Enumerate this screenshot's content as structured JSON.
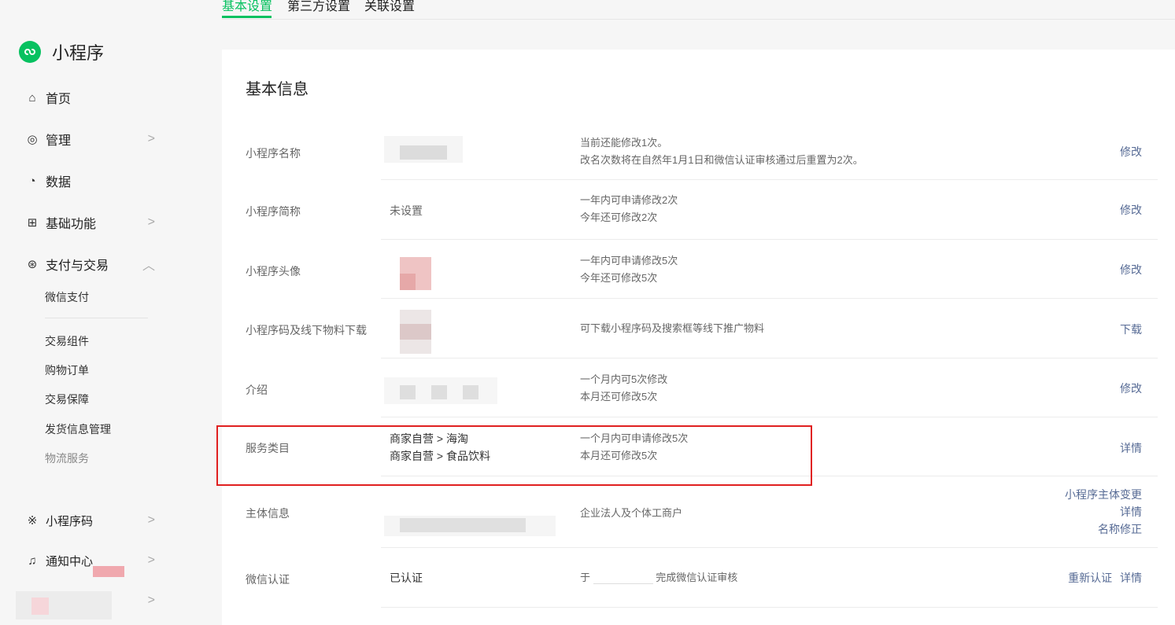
{
  "tabs": [
    "基本设置",
    "第三方设置",
    "关联设置"
  ],
  "sidebar": {
    "app_title": "小程序",
    "nav": [
      {
        "label": "首页",
        "icon": "home-icon"
      },
      {
        "label": "管理",
        "icon": "settings-icon"
      },
      {
        "label": "数据",
        "icon": "chart-icon"
      },
      {
        "label": "基础功能",
        "icon": "grid-icon"
      },
      {
        "label": "支付与交易",
        "icon": "yen-icon"
      }
    ],
    "payment_items": [
      "微信支付",
      "交易组件",
      "购物订单",
      "交易保障",
      "发货信息管理",
      "物流服务"
    ],
    "bottom_nav": [
      {
        "label": "小程序码",
        "icon": "sparkle-icon"
      },
      {
        "label": "通知中心",
        "icon": "bell-icon"
      }
    ]
  },
  "main": {
    "section_title": "基本信息",
    "rows": [
      {
        "label": "小程序名称",
        "value": "",
        "desc": [
          "当前还能修改1次。",
          "改名次数将在自然年1月1日和微信认证审核通过后重置为2次。"
        ],
        "actions": [
          "修改"
        ]
      },
      {
        "label": "小程序简称",
        "value": "未设置",
        "desc": [
          "一年内可申请修改2次",
          "今年还可修改2次"
        ],
        "actions": [
          "修改"
        ]
      },
      {
        "label": "小程序头像",
        "value": "",
        "desc": [
          "一年内可申请修改5次",
          "今年还可修改5次"
        ],
        "actions": [
          "修改"
        ]
      },
      {
        "label": "小程序码及线下物料下载",
        "value": "",
        "desc": [
          "可下载小程序码及搜索框等线下推广物料"
        ],
        "actions": [
          "下载"
        ]
      },
      {
        "label": "介绍",
        "value": "",
        "desc": [
          "一个月内可5次修改",
          "本月还可修改5次"
        ],
        "actions": [
          "修改"
        ]
      },
      {
        "label": "服务类目",
        "value_lines": [
          "商家自营 > 海淘",
          "商家自营 > 食品饮料"
        ],
        "desc": [
          "一个月内可申请修改5次",
          "本月还可修改5次"
        ],
        "actions": [
          "详情"
        ]
      },
      {
        "label": "主体信息",
        "value": "",
        "desc": [
          "企业法人及个体工商户"
        ],
        "actions": [
          "小程序主体变更",
          "详情",
          "名称修正"
        ]
      },
      {
        "label": "微信认证",
        "value": "已认证",
        "desc_prefix": "于",
        "desc_suffix": "完成微信认证审核",
        "actions": [
          "重新认证",
          "详情"
        ]
      }
    ]
  },
  "colors": {
    "accent": "#07c160",
    "link": "#576b95",
    "highlight": "#e02020"
  }
}
